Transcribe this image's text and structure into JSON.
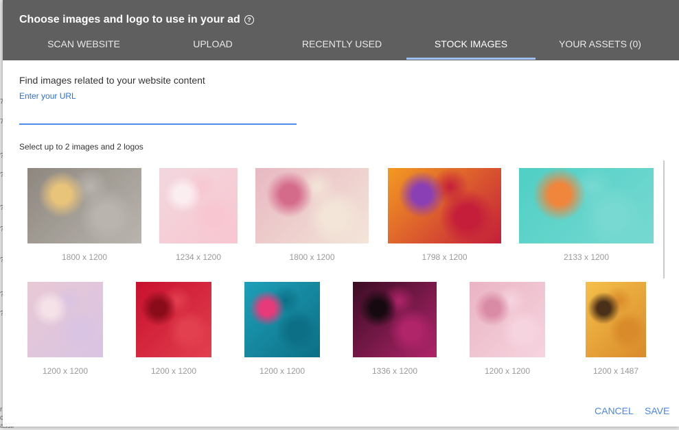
{
  "dialog": {
    "title": "Choose images and logo to use in your ad",
    "help_icon": "help-circle-icon"
  },
  "tabs": [
    {
      "label": "SCAN WEBSITE",
      "active": false
    },
    {
      "label": "UPLOAD",
      "active": false
    },
    {
      "label": "RECENTLY USED",
      "active": false
    },
    {
      "label": "STOCK IMAGES",
      "active": true
    },
    {
      "label": "YOUR ASSETS (0)",
      "active": false
    }
  ],
  "scan": {
    "heading": "Find images related to your website content",
    "url_label": "Enter your URL",
    "url_value": ""
  },
  "selection": {
    "instruction": "Select up to 2 images and 2 logos"
  },
  "images": [
    {
      "name": "delivery-man-flowers-image",
      "dims": "1800 x 1200",
      "colors": [
        "#8d8780",
        "#b9b4ad",
        "#e8c37a"
      ]
    },
    {
      "name": "cherry-blossom-image",
      "dims": "1234 x 1200",
      "colors": [
        "#f2d7de",
        "#f8c6d0",
        "#fbeef1"
      ]
    },
    {
      "name": "flower-wall-image",
      "dims": "1800 x 1200",
      "colors": [
        "#e8b8c2",
        "#f3e5d8",
        "#d56b8b"
      ]
    },
    {
      "name": "colorful-bouquet-image",
      "dims": "1798 x 1200",
      "colors": [
        "#f39a21",
        "#c41e3a",
        "#8a3fb5"
      ]
    },
    {
      "name": "lilies-on-turquoise-image",
      "dims": "2133 x 1200",
      "colors": [
        "#4fcfc5",
        "#77d9d1",
        "#f0853c"
      ]
    },
    {
      "name": "pastel-roses-image",
      "dims": "1200 x 1200",
      "colors": [
        "#e8c8d4",
        "#d9c4e3",
        "#f5e2e8"
      ]
    },
    {
      "name": "red-roses-image",
      "dims": "1200 x 1200",
      "colors": [
        "#c8102e",
        "#e2404f",
        "#8a0c1a"
      ]
    },
    {
      "name": "pink-gerbera-image",
      "dims": "1200 x 1200",
      "colors": [
        "#1ea0b8",
        "#0c6f86",
        "#e63a7a"
      ]
    },
    {
      "name": "purple-dahlia-image",
      "dims": "1336 x 1200",
      "colors": [
        "#3a0d24",
        "#b0246a",
        "#160a10"
      ]
    },
    {
      "name": "pink-roses-image",
      "dims": "1200 x 1200",
      "colors": [
        "#eab4c4",
        "#f6d4df",
        "#d98aa4"
      ]
    },
    {
      "name": "sunset-daisies-image",
      "dims": "1200 x 1487",
      "colors": [
        "#f5c04a",
        "#d98a2a",
        "#4a3018"
      ]
    }
  ],
  "actions": {
    "cancel": "CANCEL",
    "save": "SAVE"
  },
  "background_text": [
    "7",
    "7",
    "?",
    "?",
    "?",
    "?",
    "?",
    "?",
    "?",
    "r",
    "c",
    "assine"
  ]
}
